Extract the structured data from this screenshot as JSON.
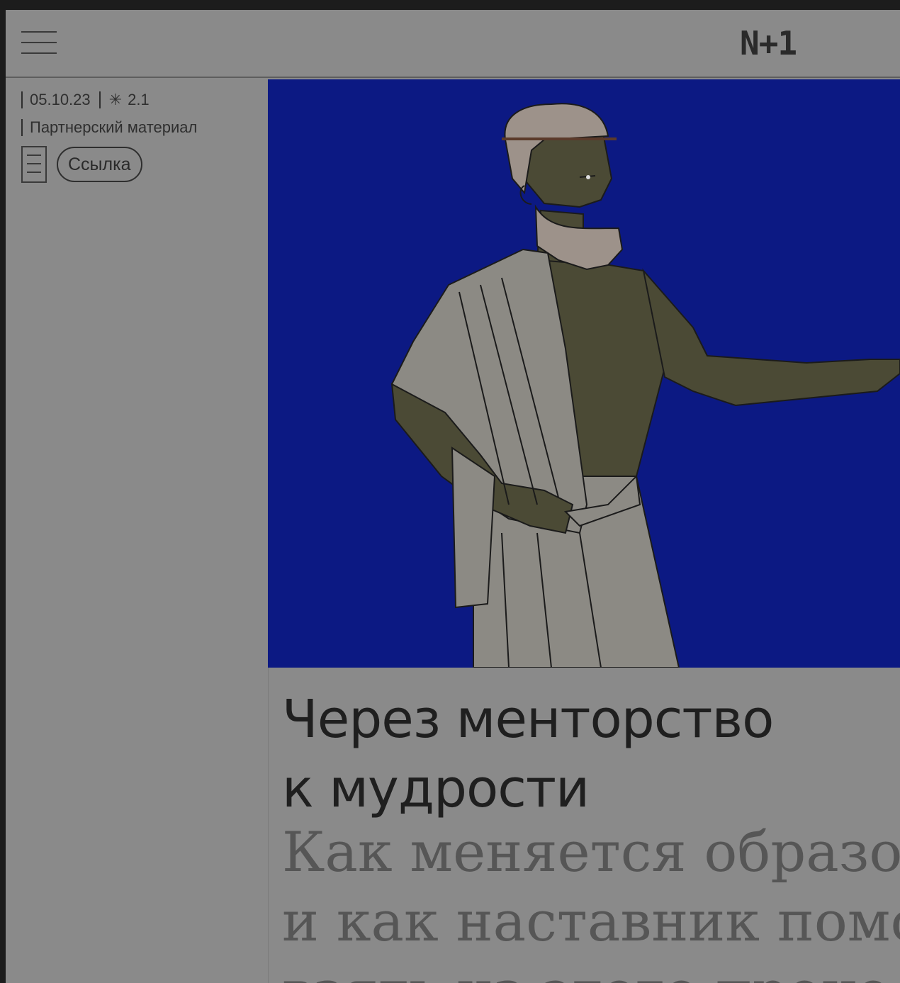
{
  "header": {
    "logo": "N+1",
    "menu_icon": "hamburger-menu-icon"
  },
  "meta": {
    "date": "05.10.23",
    "difficulty": "2.1",
    "difficulty_icon": "asterisk-icon",
    "category": "Партнерский материал",
    "doc_icon": "document-icon",
    "link_label": "Ссылка"
  },
  "hero": {
    "background_color": "#0c1983",
    "subject": "illustration-greek-philosopher"
  },
  "article": {
    "title_line1": "Через менторство",
    "title_line2": "к мудрости",
    "subtitle_line1": "Как меняется образо",
    "subtitle_line2": "и как наставник помо",
    "subtitle_line3": "взять из этого проце"
  }
}
